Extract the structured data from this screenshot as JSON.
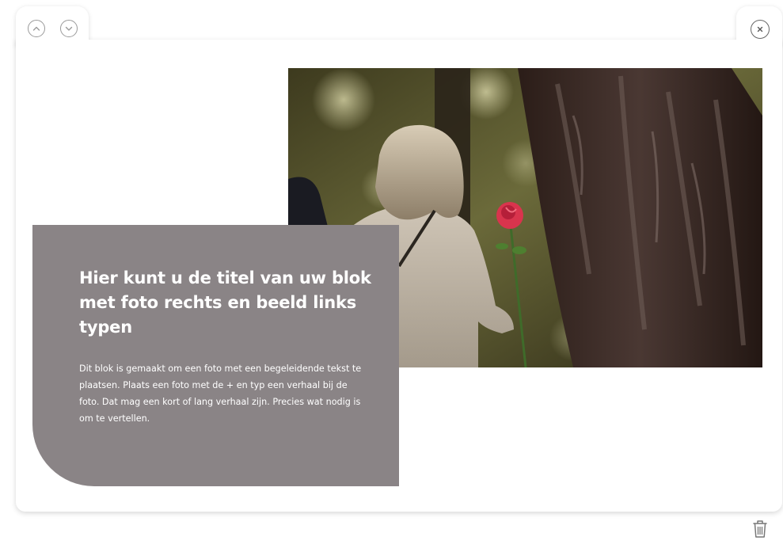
{
  "toolbar": {
    "move_up_icon": "chevron-up-icon",
    "move_down_icon": "chevron-down-icon",
    "close_icon": "close-icon",
    "delete_icon": "trash-icon"
  },
  "block": {
    "title": "Hier kunt u de titel van uw blok met foto rechts en beeld links typen",
    "body": "Dit blok is gemaakt om een foto met een begeleidende tekst te plaatsen. Plaats een foto met de + en typ een verhaal bij de foto. Dat mag een kort of lang verhaal zijn. Precies wat nodig is om te vertellen.",
    "background_color": "#8a8486",
    "text_color": "#ffffff"
  },
  "colors": {
    "card_background": "#ffffff",
    "icon_stroke": "#9a9a9a"
  }
}
